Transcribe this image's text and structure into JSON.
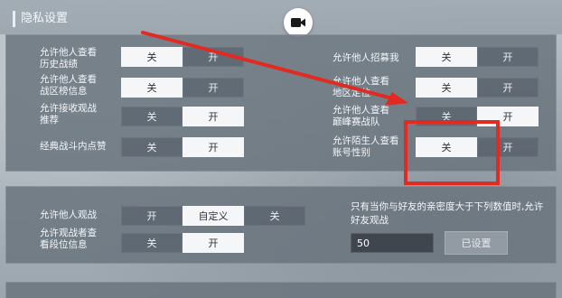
{
  "header": {
    "title": "隐私设置"
  },
  "options": {
    "off": "关",
    "on": "开",
    "custom": "自定义"
  },
  "left_rows": [
    {
      "label1": "允许他人查看",
      "label2": "历史战绩",
      "selected": "off"
    },
    {
      "label1": "允许他人查看",
      "label2": "战区榜信息",
      "selected": "off"
    },
    {
      "label1": "允许接收观战",
      "label2": "推荐",
      "selected": "on"
    },
    {
      "label1": "经典战斗内点赞",
      "label2": "",
      "selected": "on"
    }
  ],
  "right_rows": [
    {
      "label1": "允许他人招募我",
      "label2": "",
      "selected": "off"
    },
    {
      "label1": "允许他人查看",
      "label2": "地区定位",
      "selected": "off"
    },
    {
      "label1": "允许他人查看",
      "label2": "巅峰赛战队",
      "selected": "on"
    },
    {
      "label1": "允许陌生人查看",
      "label2": "账号性别",
      "selected": "off"
    }
  ],
  "spectate": {
    "row1": {
      "label": "允许他人观战",
      "selected": "custom"
    },
    "row2": {
      "label1": "允许观战者查",
      "label2": "看段位信息",
      "selected": "on"
    },
    "note": "只有当你与好友的亲密度大于下列数值时,允许好友观战",
    "intimacy_value": "50",
    "set_button": "已设置"
  },
  "colors": {
    "annotation": "#e02a22",
    "selected_bg": "#f4f6f8"
  },
  "icons": {
    "record": "video-camera-icon"
  }
}
